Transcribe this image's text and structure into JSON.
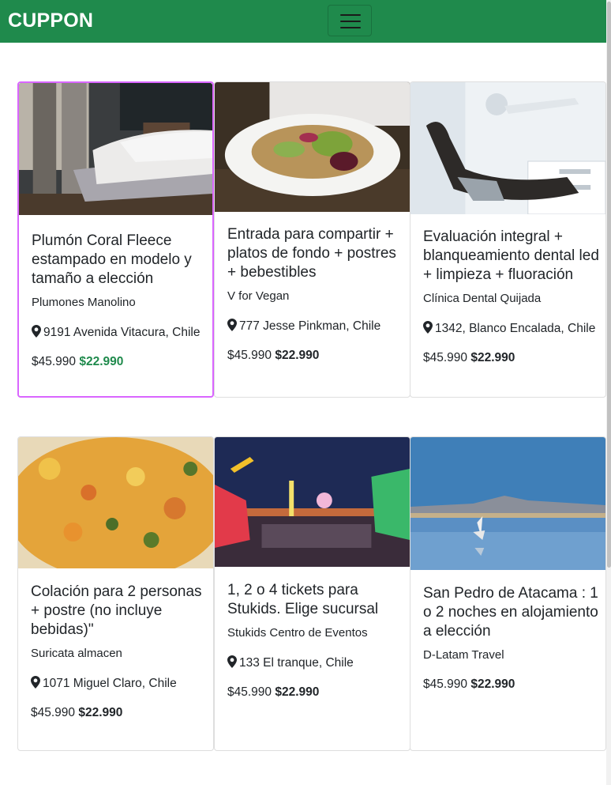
{
  "navbar": {
    "brand": "CUPPON",
    "menu_icon": "hamburger-menu-icon",
    "color": "#1f8a4c"
  },
  "cards": [
    {
      "image": "bed-photo",
      "title": "Plumón Coral Fleece estampado en modelo y tamaño a elección",
      "merchant": "Plumones Manolino",
      "location": "9191 Avenida Vitacura, Chile",
      "old_price": "$45.990",
      "new_price": "$22.990"
    },
    {
      "image": "vegan-salad-photo",
      "title": "Entrada para compartir + platos de fondo + postres + bebestibles",
      "merchant": "V for Vegan",
      "location": "777 Jesse Pinkman, Chile",
      "old_price": "$45.990",
      "new_price": "$22.990"
    },
    {
      "image": "dental-chair-photo",
      "title": "Evaluación integral + blanqueamiento dental led + limpieza + fluoración",
      "merchant": "Clínica Dental Quijada",
      "location": "1342, Blanco Encalada, Chile",
      "old_price": "$45.990",
      "new_price": "$22.990"
    },
    {
      "image": "rice-dish-photo",
      "title": "Colación para 2 personas + postre (no incluye bebidas)\"",
      "merchant": "Suricata almacen",
      "location": "1071 Miguel Claro, Chile",
      "old_price": "$45.990",
      "new_price": "$22.990"
    },
    {
      "image": "fairground-night-photo",
      "title": "1, 2 o 4 tickets para Stukids. Elige sucursal",
      "merchant": "Stukids Centro de Eventos",
      "location": "133 El tranque, Chile",
      "old_price": "$45.990",
      "new_price": "$22.990"
    },
    {
      "image": "atacama-flamingo-photo",
      "title": "San Pedro de Atacama : 1 o 2 noches en alojamiento a elección",
      "merchant": "D-Latam Travel",
      "location": "",
      "old_price": "$45.990",
      "new_price": "$22.990"
    }
  ]
}
